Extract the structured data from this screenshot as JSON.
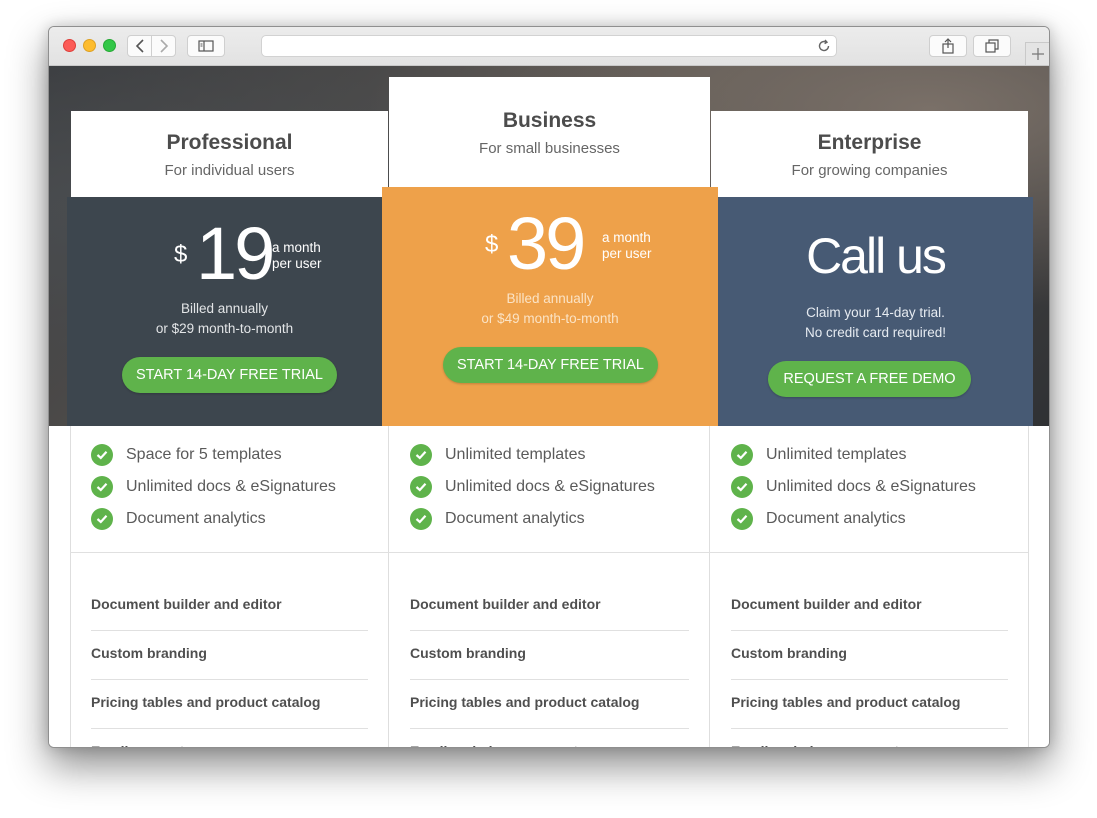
{
  "browser": {
    "url": "",
    "icons": [
      "back-icon",
      "forward-icon",
      "sidebar-icon",
      "reload-icon",
      "share-icon",
      "tabs-icon",
      "new-tab-icon"
    ]
  },
  "colors": {
    "professional_bg": "#3d464e",
    "business_bg": "#eea14a",
    "enterprise_bg": "#475a74",
    "cta_green": "#5fb34b",
    "check_green": "#5fb34b"
  },
  "plans": [
    {
      "name": "Professional",
      "tagline": "For individual users",
      "currency": "$",
      "price": "19",
      "period_line1": "a month",
      "period_line2": "per user",
      "billing_line1": "Billed annually",
      "billing_line2": "or $29 month-to-month",
      "cta": "START 14-DAY FREE TRIAL",
      "features": [
        "Space for 5 templates",
        "Unlimited docs & eSignatures",
        "Document analytics"
      ],
      "extras": [
        "Document builder and editor",
        "Custom branding",
        "Pricing tables and product catalog",
        "Email support"
      ]
    },
    {
      "name": "Business",
      "tagline": "For small businesses",
      "currency": "$",
      "price": "39",
      "period_line1": "a month",
      "period_line2": "per user",
      "billing_line1": "Billed annually",
      "billing_line2": "or $49 month-to-month",
      "cta": "START 14-DAY FREE TRIAL",
      "features": [
        "Unlimited templates",
        "Unlimited docs & eSignatures",
        "Document analytics"
      ],
      "extras": [
        "Document builder and editor",
        "Custom branding",
        "Pricing tables and product catalog",
        "Email and phone support"
      ]
    },
    {
      "name": "Enterprise",
      "tagline": "For growing companies",
      "price_text": "Call us",
      "note_line1": "Claim your 14-day trial.",
      "note_line2": "No credit card required!",
      "cta": "REQUEST A FREE DEMO",
      "features": [
        "Unlimited templates",
        "Unlimited docs & eSignatures",
        "Document analytics"
      ],
      "extras": [
        "Document builder and editor",
        "Custom branding",
        "Pricing tables and product catalog",
        "Email and phone support"
      ]
    }
  ]
}
